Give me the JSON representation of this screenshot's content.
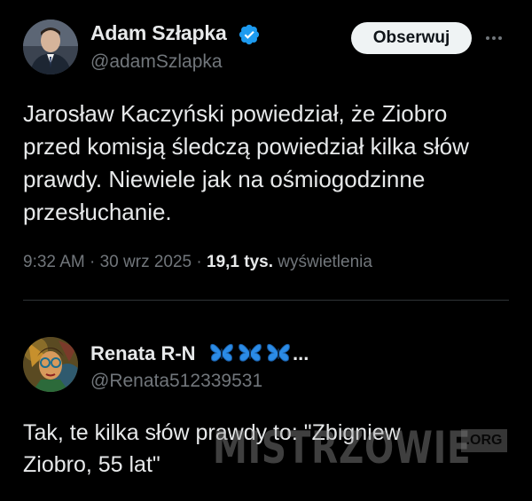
{
  "tweet": {
    "author_name": "Adam Szłapka",
    "author_handle": "@adamSzlapka",
    "follow_label": "Obserwuj",
    "text": "Jarosław Kaczyński powiedział, że Ziobro\nprzed komisją śledczą powiedział kilka słów\nprawdy. Niewiele jak na ośmiogodzinne\nprzesłuchanie.",
    "time": "9:32 AM",
    "date": "30 wrz 2025",
    "views_count": "19,1 tys.",
    "views_label": "wyświetlenia",
    "separator": "·"
  },
  "reply": {
    "author_name": "Renata R-N",
    "name_suffix": "...",
    "author_handle": "@Renata512339531",
    "text": "Tak, te kilka słów prawdy to: \"Zbigniew\nZiobro, 55 lat\""
  },
  "watermark": {
    "text": "MISTRZOWIE",
    "domain": ".ORG"
  },
  "icons": {
    "verified": "verified-badge-icon",
    "more": "more-icon",
    "butterfly": "butterfly-icon"
  },
  "colors": {
    "background": "#000000",
    "primary_text": "#e7e9ea",
    "secondary_text": "#71767b",
    "verified_blue": "#1d9bf0",
    "divider": "#2f3336",
    "follow_bg": "#eff3f4",
    "butterfly_blue": "#2b8be6"
  }
}
